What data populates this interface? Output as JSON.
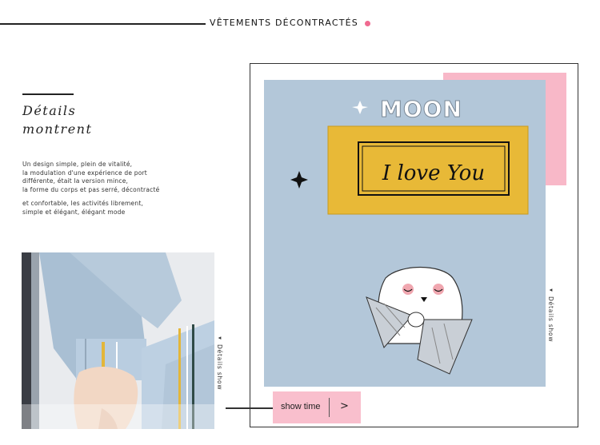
{
  "header": {
    "title": "VÊTEMENTS DÉCONTRACTÉS"
  },
  "details": {
    "title_line1": "Détails",
    "title_line2": "montrent",
    "para1": [
      "Un design simple, plein de vitalité,",
      "la modulation d'une expérience de port",
      "différente, était la version mince,",
      "la forme du corps et pas serré, décontracté"
    ],
    "para2": [
      "et confortable, les activités librement,",
      "simple et élégant, élégant mode"
    ]
  },
  "vertical_labels": {
    "small": "◂ Détails show",
    "large": "◂ Détails show"
  },
  "patch": {
    "word": "MOON",
    "label": "I love You"
  },
  "button": {
    "label": "show time",
    "arrow": ">"
  },
  "colors": {
    "pink": "#f8b8c8",
    "accent_dot": "#f06a90",
    "fabric": "#aec3d6",
    "patch_yellow": "#e7b52f"
  }
}
